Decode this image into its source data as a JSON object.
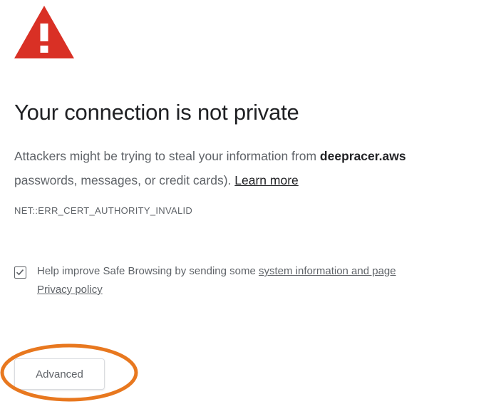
{
  "page": {
    "title": "Your connection is not private",
    "message_start": "Attackers might be trying to steal your information from ",
    "domain": "deepracer.aws",
    "message_line2": "passwords, messages, or credit cards). ",
    "learn_more": "Learn more",
    "error_code": "NET::ERR_CERT_AUTHORITY_INVALID"
  },
  "safe_browsing": {
    "checked": true,
    "text": "Help improve Safe Browsing by sending some ",
    "link": "system information and page",
    "privacy_policy": "Privacy policy"
  },
  "advanced_button": {
    "label": "Advanced"
  },
  "colors": {
    "warning_red": "#d93025",
    "highlight_orange": "#e8781f",
    "text_primary": "#202124",
    "text_secondary": "#5f6368"
  },
  "icons": {
    "warning": "warning-triangle-icon",
    "checkbox": "checkmark-icon"
  }
}
